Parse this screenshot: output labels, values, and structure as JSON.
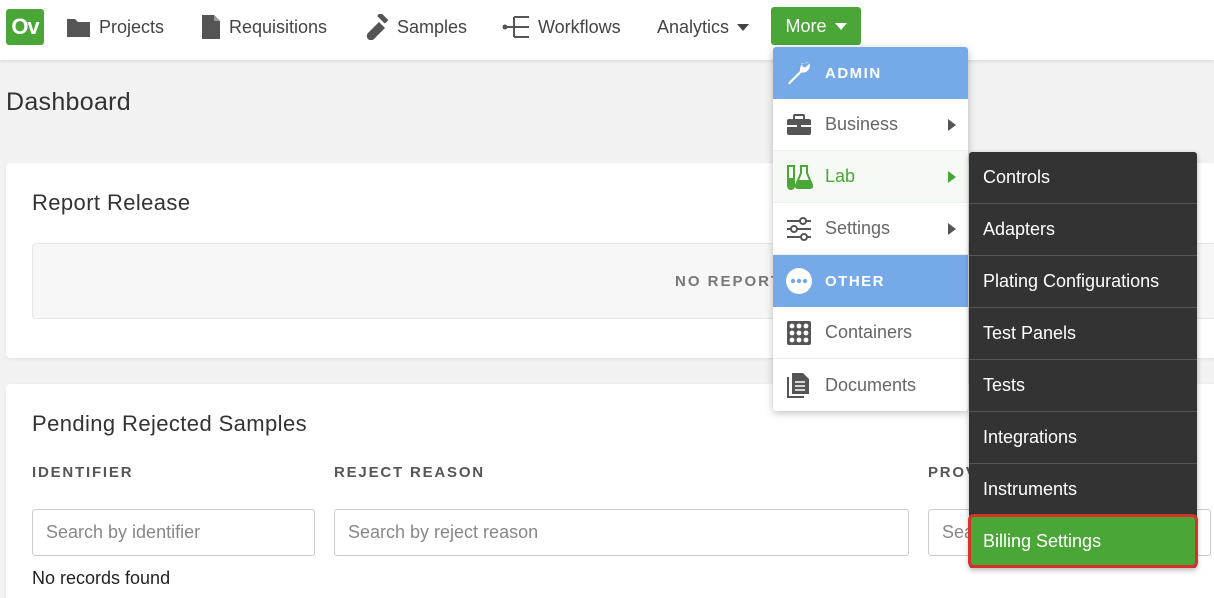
{
  "nav": {
    "logo": "Ov",
    "projects": "Projects",
    "requisitions": "Requisitions",
    "samples": "Samples",
    "workflows": "Workflows",
    "analytics": "Analytics",
    "more": "More"
  },
  "page": {
    "title": "Dashboard"
  },
  "report_release": {
    "title": "Report Release",
    "empty": "NO REPORT"
  },
  "pending": {
    "title": "Pending Rejected Samples",
    "columns": [
      "IDENTIFIER",
      "REJECT REASON",
      "PROV"
    ],
    "placeholders": [
      "Search by identifier",
      "Search by reject reason",
      "Sea"
    ],
    "empty": "No records found"
  },
  "more_menu": {
    "admin_header": "ADMIN",
    "business": "Business",
    "lab": "Lab",
    "settings": "Settings",
    "other_header": "OTHER",
    "containers": "Containers",
    "documents": "Documents"
  },
  "lab_submenu": {
    "items": [
      "Controls",
      "Adapters",
      "Plating Configurations",
      "Test Panels",
      "Tests",
      "Integrations",
      "Instruments",
      "Billing Settings"
    ]
  },
  "colors": {
    "brand_green": "#4aa637",
    "header_blue": "#76a9e8",
    "submenu_bg": "#333333",
    "highlight_red": "#d6322a"
  }
}
